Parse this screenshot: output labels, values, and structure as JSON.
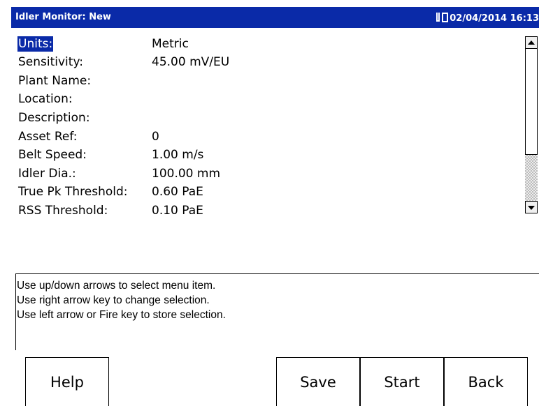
{
  "header": {
    "title": "Idler Monitor: New",
    "datetime": "02/04/2014 16:13",
    "status_icon": "battery-plug-icon"
  },
  "settings": [
    {
      "label": "Units:",
      "value": "Metric",
      "selected": true
    },
    {
      "label": "Sensitivity:",
      "value": "45.00 mV/EU"
    },
    {
      "label": "Plant Name:",
      "value": ""
    },
    {
      "label": "Location:",
      "value": ""
    },
    {
      "label": "Description:",
      "value": ""
    },
    {
      "label": "Asset Ref:",
      "value": "0"
    },
    {
      "label": "Belt Speed:",
      "value": "1.00 m/s"
    },
    {
      "label": "Idler Dia.:",
      "value": "100.00 mm"
    },
    {
      "label": "True Pk Threshold:",
      "value": "0.60 PaE"
    },
    {
      "label": "RSS Threshold:",
      "value": "0.10 PaE"
    }
  ],
  "help": {
    "lines": [
      "Use up/down arrows to select menu item.",
      "Use right arrow key to change selection.",
      "Use left arrow or Fire key to store selection."
    ]
  },
  "softkeys": {
    "help": "Help",
    "save": "Save",
    "start": "Start",
    "back": "Back"
  },
  "colors": {
    "titlebar": "#0a2aa8",
    "selection": "#0a2aa8"
  }
}
